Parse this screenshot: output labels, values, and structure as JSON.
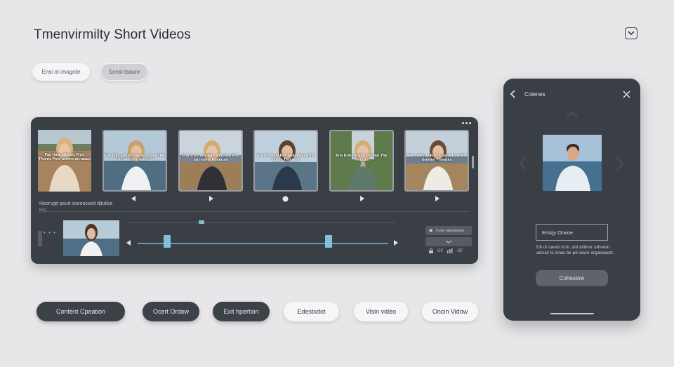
{
  "page": {
    "title": "Tmenvirmilty Short Videos"
  },
  "header": {
    "icon": "chevron-down-icon"
  },
  "tabs": {
    "first_label": "Ensi ol imagnte",
    "second_label": "Sonsl tsaure"
  },
  "editor": {
    "thumbnails": [
      {
        "caption": "Fan itma attiasty Fnnt Thonts Pow wonns an,ruaes"
      },
      {
        "caption": "Ffis tvaz antuh Chane smaunt Fhi orumies Tne Forvuss"
      },
      {
        "caption": "Fruris sonmy Eas ahautiea Fon tol nomte Fnanuss"
      },
      {
        "caption": "Fre tosmmy Fos ahautiness Ihe bufne Thuness"
      },
      {
        "caption": "Fne Entuire Ekir thetian Thy Fentuss"
      },
      {
        "caption": "Fnt mtlevuy Fuom ushadnra Fin Gontes Yneenss"
      }
    ],
    "controls": [
      "play-icon",
      "play-icon",
      "record-icon",
      "play-icon",
      "play-icon"
    ],
    "subtitle_text": "Hoorugtt peurt sceoncsed djtutlce",
    "hd_label": "HO",
    "side_dots": "• • •",
    "tools": {
      "top_label": "Fuus opesessss",
      "middle_label": ""
    },
    "tool_icons": {
      "lock": "lock-icon",
      "text1": "GF",
      "bars": "bars-icon",
      "text2": "OF"
    }
  },
  "bottom_buttons": [
    {
      "label": "Content Cpeation",
      "style": "dark"
    },
    {
      "label": "Ocert Ordow",
      "style": "dark"
    },
    {
      "label": "Exit hpertion",
      "style": "dark"
    },
    {
      "label": "Edestxdot",
      "style": "light"
    },
    {
      "label": "Visin video",
      "style": "light"
    },
    {
      "label": "Oncin Vidow",
      "style": "light"
    }
  ],
  "phone": {
    "title": "Colenes",
    "field_value": "Enisjy Orwoe",
    "description": "Dti or carvts tcm, oril shitnsr orhoem anrusl tc onae be pil iowre orgaoeaort.",
    "button_label": "Cohestow"
  },
  "colors": {
    "background": "#e7e7ea",
    "panel": "#3a3e45",
    "accent": "#7fc3d4"
  }
}
